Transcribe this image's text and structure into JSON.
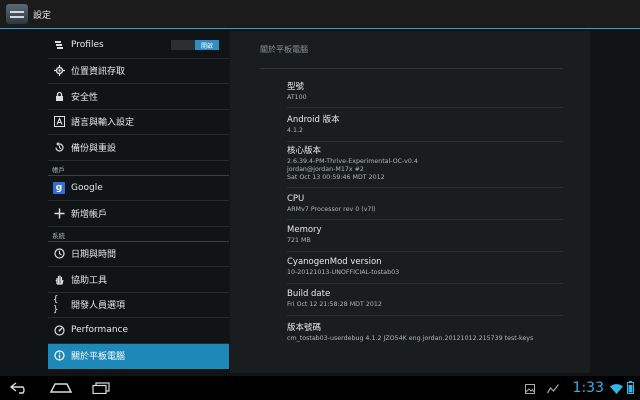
{
  "actionbar": {
    "title": "設定",
    "icon": "settings-icon"
  },
  "sidebar": {
    "profiles": {
      "label": "Profiles",
      "toggle_on": "開啟",
      "icon": "profiles-icon"
    },
    "items": [
      {
        "label": "位置資訊存取",
        "icon": "location-icon"
      },
      {
        "label": "安全性",
        "icon": "lock-icon"
      },
      {
        "label": "語言與輸入設定",
        "icon": "language-icon"
      },
      {
        "label": "備份與重設",
        "icon": "backup-icon"
      }
    ],
    "accounts_header": "帳戶",
    "accounts": [
      {
        "label": "Google",
        "icon": "google-icon"
      },
      {
        "label": "新增帳戶",
        "icon": "add-icon"
      }
    ],
    "system_header": "系統",
    "system": [
      {
        "label": "日期與時間",
        "icon": "clock-icon"
      },
      {
        "label": "協助工具",
        "icon": "hand-icon"
      },
      {
        "label": "開發人員選項",
        "icon": "braces-icon"
      },
      {
        "label": "Performance",
        "icon": "performance-icon"
      },
      {
        "label": "關於平板電腦",
        "icon": "info-icon",
        "selected": true
      }
    ]
  },
  "detail": {
    "title": "關於平板電腦",
    "items": [
      {
        "label": "型號",
        "value": [
          "AT100"
        ]
      },
      {
        "label": "Android 版本",
        "value": [
          "4.1.2"
        ]
      },
      {
        "label": "核心版本",
        "value": [
          "2.6.39.4-PM-Thrive-Experimental-OC-v0.4",
          "jordan@jordan-M17x #2",
          "Sat Oct 13 00:59:46 MDT 2012"
        ]
      },
      {
        "label": "CPU",
        "value": [
          "ARMv7 Processor rev 0 (v7l)"
        ]
      },
      {
        "label": "Memory",
        "value": [
          "721 MB"
        ]
      },
      {
        "label": "CyanogenMod version",
        "value": [
          "10-20121013-UNOFFICIAL-tostab03"
        ]
      },
      {
        "label": "Build date",
        "value": [
          "Fri Oct 12 21:58:28 MDT 2012"
        ]
      },
      {
        "label": "版本號碼",
        "value": [
          "cm_tostab03-userdebug 4.1.2 JZO54K eng.jordan.20121012.215739 test-keys"
        ]
      }
    ]
  },
  "navbar": {
    "back": "back-icon",
    "home": "home-icon",
    "recents": "recents-icon",
    "clock": "1:33",
    "accent": "#33b5e5"
  }
}
